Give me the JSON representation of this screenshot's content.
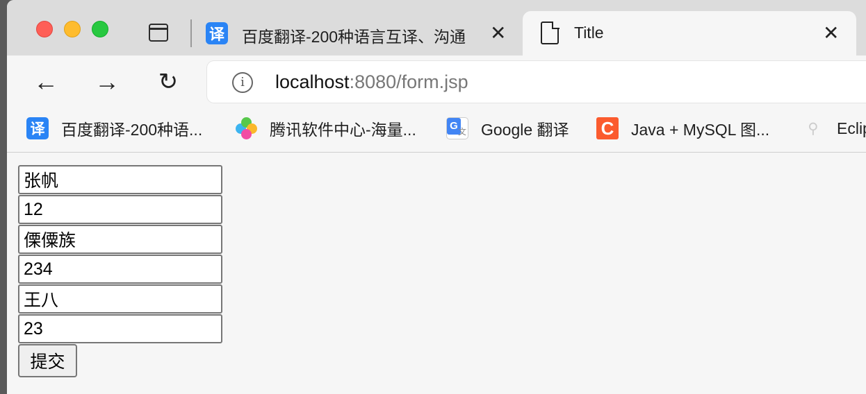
{
  "browser": {
    "tabs": [
      {
        "title": "百度翻译-200种语言互译、沟通",
        "favicon": "百度翻译 译 icon",
        "favicon_char": "译",
        "close": "✕",
        "active": false
      },
      {
        "title": "Title",
        "favicon": "document-icon",
        "close": "✕",
        "active": true
      }
    ],
    "nav": {
      "back": "←",
      "forward": "→",
      "reload": "↻"
    },
    "url": {
      "info": "i",
      "host": "localhost",
      "path": ":8080/form.jsp"
    },
    "bookmarks": [
      {
        "label": "百度翻译-200种语...",
        "icon": "baidu-translate-icon",
        "icon_char": "译",
        "color": "#2a84f5"
      },
      {
        "label": "腾讯软件中心-海量...",
        "icon": "tencent-software-icon",
        "color": "#multicolor"
      },
      {
        "label": "Google 翻译",
        "icon": "google-translate-icon",
        "icon_char": "G",
        "color": "#4285f4"
      },
      {
        "label": "Java + MySQL 图...",
        "icon": "csdn-icon",
        "icon_char": "C",
        "color": "#fb5b2e"
      },
      {
        "label": "Eclip",
        "icon": "eclipse-icon",
        "icon_char": "⚲",
        "color": "#cccccc"
      }
    ]
  },
  "form": {
    "fields": [
      "张帆",
      "12",
      "傈僳族",
      "234",
      "王八",
      "23"
    ],
    "submit_label": "提交"
  }
}
